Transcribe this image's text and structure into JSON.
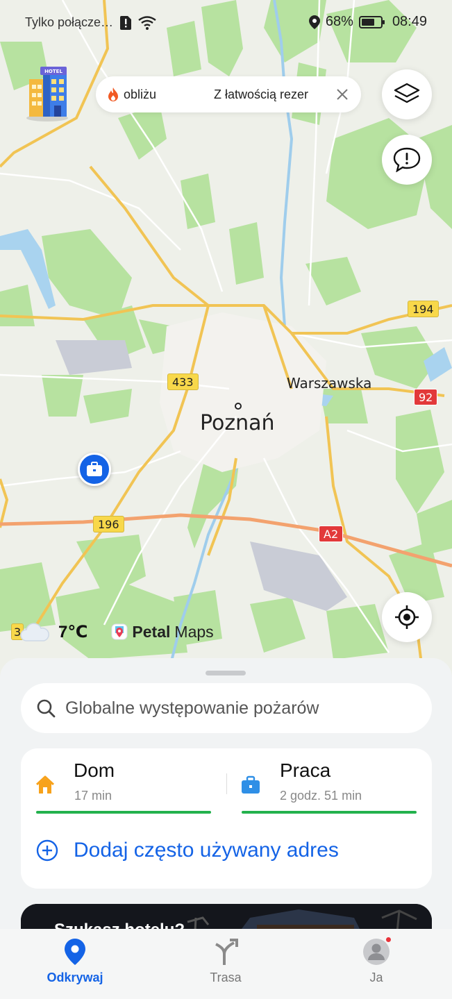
{
  "status_bar": {
    "connection": "Tylko połącze…",
    "battery": "68%",
    "battery_level": 0.68,
    "time": "08:49"
  },
  "banner": {
    "near_label": "obliżu",
    "promo": "Z łatwością rezerw"
  },
  "map": {
    "city": "Poznań",
    "district": "Warszawska",
    "roads": [
      "194",
      "433",
      "92",
      "196",
      "A2",
      "3"
    ],
    "weather_temp": "7℃",
    "brand_petal": "Petal",
    "brand_maps": "Maps"
  },
  "search": {
    "placeholder": "Globalne występowanie pożarów"
  },
  "places": {
    "home": {
      "name": "Dom",
      "time": "17 min"
    },
    "work": {
      "name": "Praca",
      "time": "2 godz. 51 min"
    },
    "add_label": "Dodaj często używany adres"
  },
  "promo_card": {
    "title": "Szukasz hotelu?"
  },
  "nav": {
    "discover": "Odkrywaj",
    "route": "Trasa",
    "me": "Ja"
  },
  "colors": {
    "accent": "#1463e6",
    "green": "#23b14d",
    "home_icon": "#f7a21b",
    "work_icon": "#2f8fe6"
  }
}
